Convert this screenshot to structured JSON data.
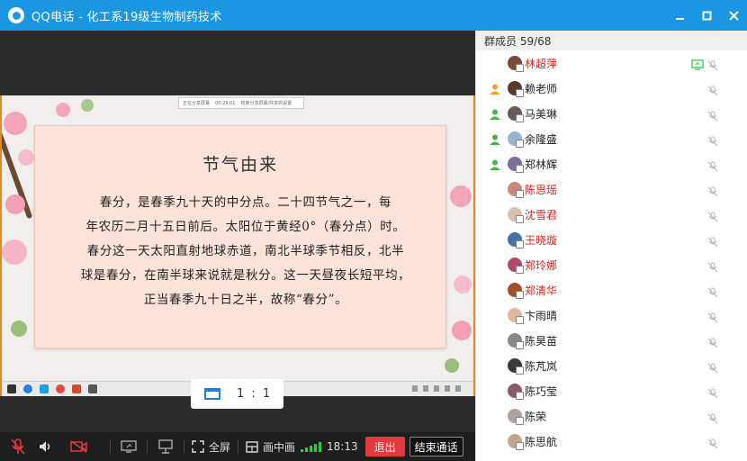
{
  "window": {
    "title": "QQ电话 - 化工系19级生物制药技术",
    "controls": [
      "minimize",
      "maximize",
      "close"
    ]
  },
  "slide": {
    "topbar_items": [
      "正在分享屏幕",
      "00:29:01",
      "结束分享屏幕/共享的设置"
    ],
    "heading": "节气由来",
    "lines": [
      "春分，是春季九十天的中分点。二十四节气之一，每",
      "年农历二月十五日前后。太阳位于黄经0°（春分点）时。",
      "春分这一天太阳直射地球赤道，南北半球季节相反，北半",
      "球是春分，在南半球来说就是秋分。这一天昼夜长短平均，",
      "正当春季九十日之半，故称“春分”。"
    ]
  },
  "ratio_button": {
    "label": "1 : 1"
  },
  "toolbar": {
    "fullscreen_label": "全屏",
    "pip_label": "画中画",
    "time": "18:13",
    "exit_label": "退出",
    "end_call_label": "结束通话"
  },
  "panel": {
    "header": "群成员 59/68",
    "members": [
      {
        "name": "林超萍",
        "highlight": true,
        "host": false,
        "sharing": true,
        "avatar_color": "#7a4a3a"
      },
      {
        "name": "赖老师",
        "highlight": false,
        "host": true,
        "sharing": false,
        "avatar_color": "#5a3a2a"
      },
      {
        "name": "马美琳",
        "highlight": false,
        "host": true,
        "sharing": false,
        "avatar_color": "#6a5a5a"
      },
      {
        "name": "余隆盛",
        "highlight": false,
        "host": true,
        "sharing": false,
        "avatar_color": "#9ab4d0"
      },
      {
        "name": "郑林辉",
        "highlight": false,
        "host": true,
        "sharing": false,
        "avatar_color": "#7b6f9a"
      },
      {
        "name": "陈思瑶",
        "highlight": true,
        "host": false,
        "sharing": false,
        "avatar_color": "#c88a7a"
      },
      {
        "name": "沈雪君",
        "highlight": true,
        "host": false,
        "sharing": false,
        "avatar_color": "#d8c0b0"
      },
      {
        "name": "王晓璇",
        "highlight": true,
        "host": false,
        "sharing": false,
        "avatar_color": "#4a6fa5"
      },
      {
        "name": "郑玲娜",
        "highlight": true,
        "host": false,
        "sharing": false,
        "avatar_color": "#b04a6a"
      },
      {
        "name": "郑清华",
        "highlight": true,
        "host": false,
        "sharing": false,
        "avatar_color": "#a0522d"
      },
      {
        "name": "卞雨晴",
        "highlight": false,
        "host": false,
        "sharing": false,
        "avatar_color": "#e0b8a0"
      },
      {
        "name": "陈昊苗",
        "highlight": false,
        "host": false,
        "sharing": false,
        "avatar_color": "#888888"
      },
      {
        "name": "陈芃岚",
        "highlight": false,
        "host": false,
        "sharing": false,
        "avatar_color": "#3a3a3a"
      },
      {
        "name": "陈巧莹",
        "highlight": false,
        "host": false,
        "sharing": false,
        "avatar_color": "#8a5a6a"
      },
      {
        "name": "陈荣",
        "highlight": false,
        "host": false,
        "sharing": false,
        "avatar_color": "#b0a0a0"
      },
      {
        "name": "陈思航",
        "highlight": false,
        "host": false,
        "sharing": false,
        "avatar_color": "#c0a890"
      }
    ]
  },
  "colors": {
    "titlebar": "#1a96e3",
    "highlight_name": "#e02020",
    "exit_button": "#e0393e",
    "signal": "#2ecc40",
    "host_icon": "#f0a030",
    "host_icon_alt": "#4caf50"
  }
}
